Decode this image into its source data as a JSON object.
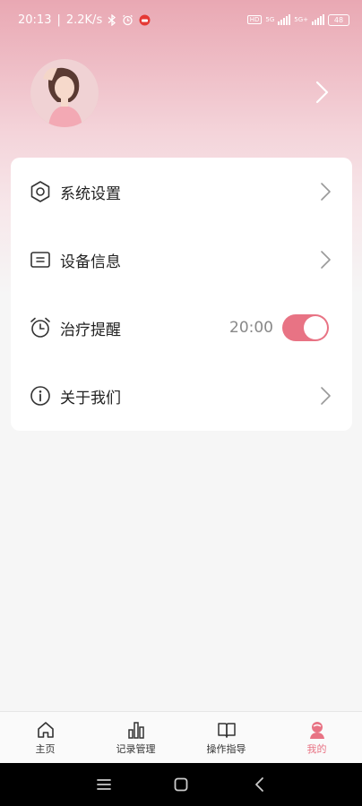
{
  "status_bar": {
    "time": "20:13",
    "net_speed": "2.2K/s",
    "battery": "48",
    "hd_tag": "HD",
    "net_tag_1": "5G",
    "net_tag_2": "5G+"
  },
  "profile": {
    "avatar": "user-avatar-photo",
    "chevron": "chevron-right-icon"
  },
  "menu": [
    {
      "label": "系统设置",
      "icon": "settings-hexagon-icon"
    },
    {
      "label": "设备信息",
      "icon": "device-info-icon"
    },
    {
      "label": "治疗提醒",
      "icon": "alarm-clock-icon",
      "time": "20:00",
      "toggle_on": true
    },
    {
      "label": "关于我们",
      "icon": "info-icon"
    }
  ],
  "tabs": [
    {
      "label": "主页",
      "icon": "home-icon",
      "active": false
    },
    {
      "label": "记录管理",
      "icon": "bar-chart-icon",
      "active": false
    },
    {
      "label": "操作指导",
      "icon": "book-icon",
      "active": false
    },
    {
      "label": "我的",
      "icon": "user-icon",
      "active": true
    }
  ],
  "colors": {
    "accent": "#e87384",
    "header_top": "#e9a8b3",
    "background": "#f6f6f6"
  }
}
